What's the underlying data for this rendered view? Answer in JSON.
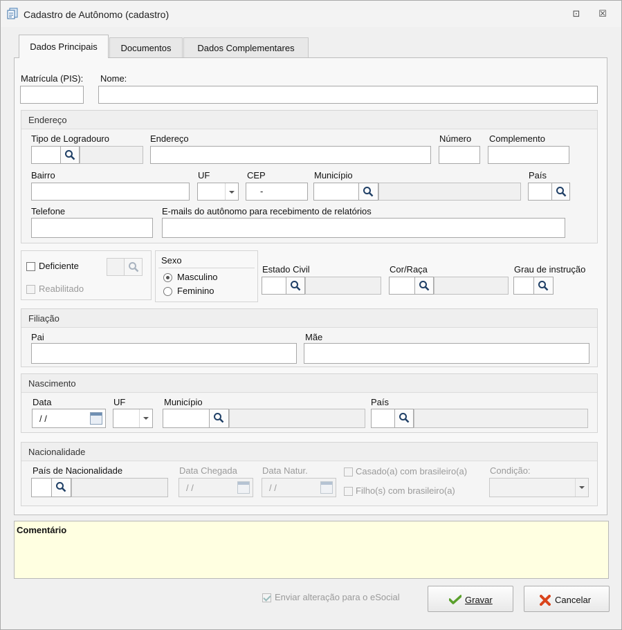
{
  "window": {
    "title": "Cadastro de Autônomo (cadastro)",
    "minimize_glyph": "⊡",
    "close_glyph": "☒"
  },
  "tabs": [
    {
      "label": "Dados Principais",
      "active": true
    },
    {
      "label": "Documentos",
      "active": false
    },
    {
      "label": "Dados Complementares",
      "active": false
    }
  ],
  "main": {
    "matricula_label": "Matrícula (PIS):",
    "matricula_value": "",
    "nome_label": "Nome:",
    "nome_value": ""
  },
  "endereco": {
    "title": "Endereço",
    "tipo_logradouro_label": "Tipo de Logradouro",
    "endereco_label": "Endereço",
    "numero_label": "Número",
    "complemento_label": "Complemento",
    "bairro_label": "Bairro",
    "uf_label": "UF",
    "cep_label": "CEP",
    "cep_value": "-",
    "municipio_label": "Município",
    "pais_label": "País",
    "telefone_label": "Telefone",
    "emails_label": "E-mails do autônomo para recebimento de relatórios"
  },
  "pessoal": {
    "deficiente_label": "Deficiente",
    "reabilitado_label": "Reabilitado",
    "sexo_title": "Sexo",
    "masculino_label": "Masculino",
    "feminino_label": "Feminino",
    "sexo_selected": "Masculino",
    "estado_civil_label": "Estado Civil",
    "cor_raca_label": "Cor/Raça",
    "grau_instrucao_label": "Grau de instrução"
  },
  "filiacao": {
    "title": "Filiação",
    "pai_label": "Pai",
    "mae_label": "Mãe"
  },
  "nascimento": {
    "title": "Nascimento",
    "data_label": "Data",
    "data_value": "/ /",
    "uf_label": "UF",
    "municipio_label": "Município",
    "pais_label": "País"
  },
  "nacionalidade": {
    "title": "Nacionalidade",
    "pais_label": "País de Nacionalidade",
    "data_chegada_label": "Data Chegada",
    "data_chegada_value": "/ /",
    "data_natur_label": "Data Natur.",
    "data_natur_value": "/ /",
    "casado_label": "Casado(a) com brasileiro(a)",
    "filhos_label": "Filho(s) com brasileiro(a)",
    "condicao_label": "Condição:"
  },
  "comentario": {
    "label": "Comentário"
  },
  "footer": {
    "esocial_label": "Enviar alteração para o eSocial",
    "esocial_checked": true,
    "gravar_label": "Gravar",
    "cancelar_label": "Cancelar"
  },
  "colors": {
    "comment_bg": "#ffffe1",
    "gravar_icon": "#5aa02c",
    "cancelar_icon": "#d9441c"
  }
}
